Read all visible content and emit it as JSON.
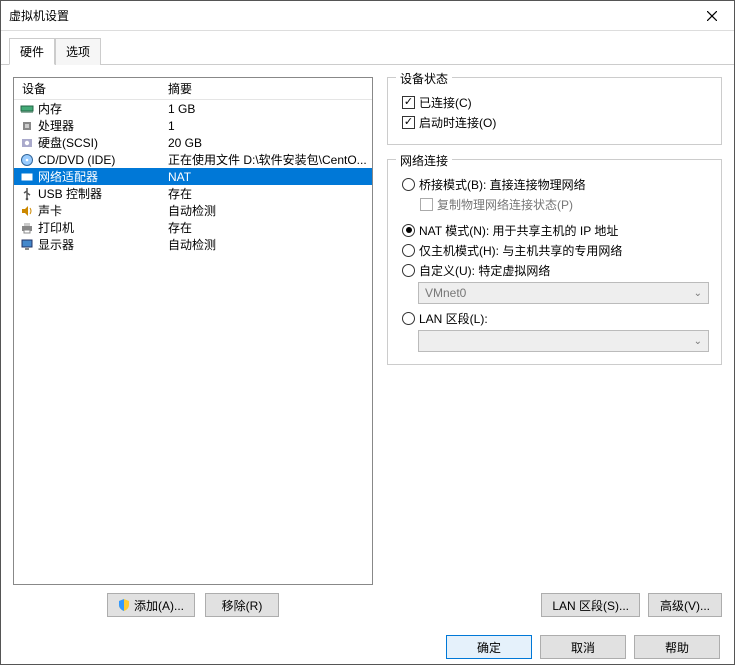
{
  "title": "虚拟机设置",
  "tabs": {
    "hw": "硬件",
    "opt": "选项"
  },
  "headers": {
    "device": "设备",
    "summary": "摘要"
  },
  "rows": [
    {
      "icon": "memory",
      "name": "内存",
      "summary": "1 GB"
    },
    {
      "icon": "cpu",
      "name": "处理器",
      "summary": "1"
    },
    {
      "icon": "disk",
      "name": "硬盘(SCSI)",
      "summary": "20 GB"
    },
    {
      "icon": "cd",
      "name": "CD/DVD (IDE)",
      "summary": "正在使用文件 D:\\软件安装包\\CentO..."
    },
    {
      "icon": "net",
      "name": "网络适配器",
      "summary": "NAT"
    },
    {
      "icon": "usb",
      "name": "USB 控制器",
      "summary": "存在"
    },
    {
      "icon": "sound",
      "name": "声卡",
      "summary": "自动检测"
    },
    {
      "icon": "print",
      "name": "打印机",
      "summary": "存在"
    },
    {
      "icon": "display",
      "name": "显示器",
      "summary": "自动检测"
    }
  ],
  "btn": {
    "add": "添加(A)...",
    "remove": "移除(R)",
    "ok": "确定",
    "cancel": "取消",
    "help": "帮助",
    "lan": "LAN 区段(S)...",
    "adv": "高级(V)..."
  },
  "grp": {
    "status_title": "设备状态",
    "connected": "已连接(C)",
    "connect_on": "启动时连接(O)",
    "net_title": "网络连接",
    "bridge": "桥接模式(B): 直接连接物理网络",
    "replicate": "复制物理网络连接状态(P)",
    "nat": "NAT 模式(N): 用于共享主机的 IP 地址",
    "host": "仅主机模式(H): 与主机共享的专用网络",
    "custom": "自定义(U): 特定虚拟网络",
    "vmnet": "VMnet0",
    "lan_label": "LAN 区段(L):"
  }
}
